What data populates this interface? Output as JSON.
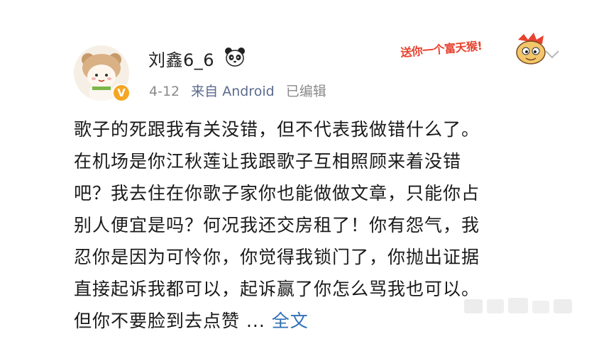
{
  "post": {
    "author": "刘鑫6_6",
    "date": "4-12",
    "source": "来自 Android",
    "edited": "已编辑",
    "sticker_text": "送你一个富天猴!",
    "content_lines": [
      "歌子的死跟我有关没错，但不代表我做错什么了。",
      "在机场是你江秋莲让我跟歌子互相照顾来着没错",
      "吧？我去住在你歌子家你也能做做文章，只能你占",
      "别人便宜是吗？何况我还交房租了！你有怨气，我",
      "忍你是因为可怜你，你觉得我锁门了，你抛出证据",
      "直接起诉我都可以，起诉赢了你怎么骂我也可以。",
      "但你不要脸到去点赞 ..."
    ],
    "more_link": "全文"
  },
  "icons": {
    "avatar": "bear-hat-avatar",
    "verified": "verified-badge-icon",
    "name_emoji": "panda-icon",
    "menu": "chevron-down-icon"
  },
  "colors": {
    "link": "#2f6fb5",
    "meta": "#8a8a8a",
    "verified": "#f5a623",
    "sticker": "#e8422f"
  }
}
